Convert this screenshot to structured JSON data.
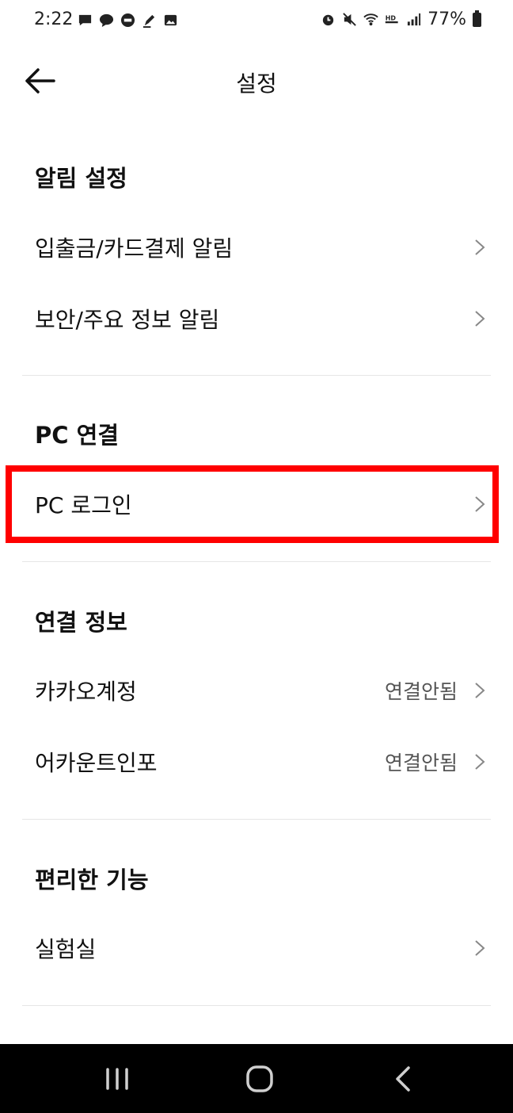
{
  "status_bar": {
    "time": "2:22",
    "battery": "77%",
    "left_icons": [
      "message-icon",
      "chat-bubble-icon",
      "talk-icon",
      "pen-icon",
      "image-icon"
    ],
    "right_icons": [
      "alarm-icon",
      "mute-icon",
      "wifi-icon",
      "hd-voice-icon",
      "signal-icon",
      "battery-icon"
    ]
  },
  "header": {
    "title": "설정",
    "back_icon": "arrow-left-icon"
  },
  "sections": {
    "notifications": {
      "title": "알림 설정",
      "items": [
        {
          "label": "입출금/카드결제 알림"
        },
        {
          "label": "보안/주요 정보 알림"
        }
      ]
    },
    "pc": {
      "title": "PC 연결",
      "items": [
        {
          "label": "PC 로그인"
        }
      ]
    },
    "connections": {
      "title": "연결 정보",
      "items": [
        {
          "label": "카카오계정",
          "value": "연결안됨"
        },
        {
          "label": "어카운트인포",
          "value": "연결안됨"
        }
      ]
    },
    "features": {
      "title": "편리한 기능",
      "items": [
        {
          "label": "실험실"
        }
      ]
    }
  },
  "colors": {
    "highlight": "#ff0000",
    "nav_bar": "#000000",
    "divider": "#e6e6e6",
    "secondary_text": "#555555"
  },
  "nav": {
    "icons": [
      "recent-apps-icon",
      "home-icon",
      "back-icon"
    ]
  }
}
